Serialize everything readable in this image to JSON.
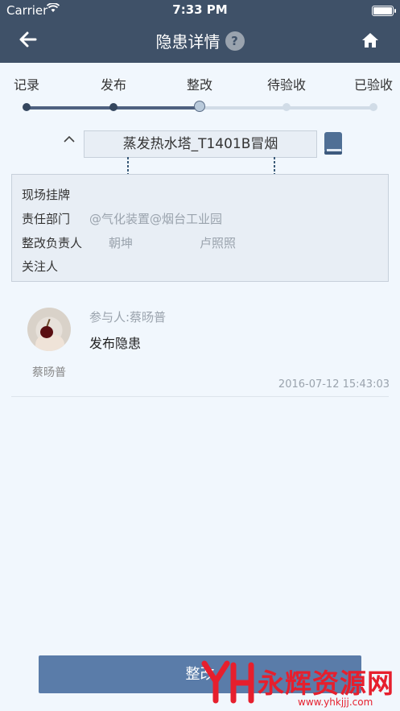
{
  "status_bar": {
    "carrier": "Carrier",
    "time": "7:33 PM"
  },
  "nav": {
    "title": "隐患详情",
    "help": "?"
  },
  "steps": [
    {
      "label": "记录",
      "state": "done"
    },
    {
      "label": "发布",
      "state": "done"
    },
    {
      "label": "整改",
      "state": "current"
    },
    {
      "label": "待验收",
      "state": "pending"
    },
    {
      "label": "已验收",
      "state": "pending"
    }
  ],
  "hazard": {
    "title": "蒸发热水塔_T1401B冒烟"
  },
  "info": {
    "row1_label": "现场挂牌",
    "dept_label": "责任部门",
    "dept_value": "@气化装置@烟台工业园",
    "owner_label": "整改负责人",
    "owner_1": "朝坤",
    "owner_2": "卢照照",
    "watcher_label": "关注人"
  },
  "record": {
    "user": "蔡旸普",
    "participant": "参与人:蔡旸普",
    "action": "发布隐患",
    "time": "2016-07-12 15:43:03"
  },
  "bottom_button": "整改",
  "watermark": {
    "title": "永辉资源网",
    "url": "www.yhkjjj.com"
  },
  "colors": {
    "header": "#3f5168",
    "background": "#f1f7fd",
    "button": "#5a7ca9",
    "watermark": "#e61f2d"
  }
}
